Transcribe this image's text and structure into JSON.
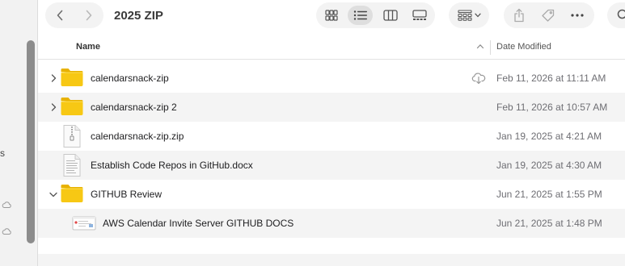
{
  "window": {
    "title": "2025 ZIP"
  },
  "sidebar": {
    "label_fragment": "s"
  },
  "toolbar": {
    "back_icon": "chevron-left-icon",
    "forward_icon": "chevron-right-icon",
    "view_modes": [
      "icon-view",
      "list-view",
      "column-view",
      "gallery-view"
    ],
    "active_view": "list-view"
  },
  "columns": {
    "name": "Name",
    "date_modified": "Date Modified"
  },
  "files": [
    {
      "name": "calendarsnack-zip",
      "date": "Feb 11, 2026 at 11:11 AM",
      "kind": "folder",
      "expander": "collapsed",
      "icloud": true
    },
    {
      "name": "calendarsnack-zip 2",
      "date": "Feb 11, 2026 at 10:57 AM",
      "kind": "folder",
      "expander": "collapsed",
      "icloud": false
    },
    {
      "name": "calendarsnack-zip.zip",
      "date": "Jan 19, 2025 at 4:21 AM",
      "kind": "zip",
      "expander": "none",
      "icloud": false
    },
    {
      "name": "Establish Code Repos in GitHub.docx",
      "date": "Jan 19, 2025 at 4:30 AM",
      "kind": "document",
      "expander": "none",
      "icloud": false
    },
    {
      "name": "GITHUB Review",
      "date": "Jun 21, 2025 at 1:55 PM",
      "kind": "folder",
      "expander": "expanded",
      "icloud": false
    },
    {
      "name": "AWS Calendar Invite Server GITHUB DOCS",
      "date": "Jun 21, 2025 at 1:48 PM",
      "kind": "screenshot",
      "expander": "none",
      "icloud": false
    }
  ],
  "colors": {
    "folder": "#f5c518",
    "folder_dark": "#e0a800",
    "row_alt": "#f4f4f4",
    "accent": "#007aff"
  }
}
